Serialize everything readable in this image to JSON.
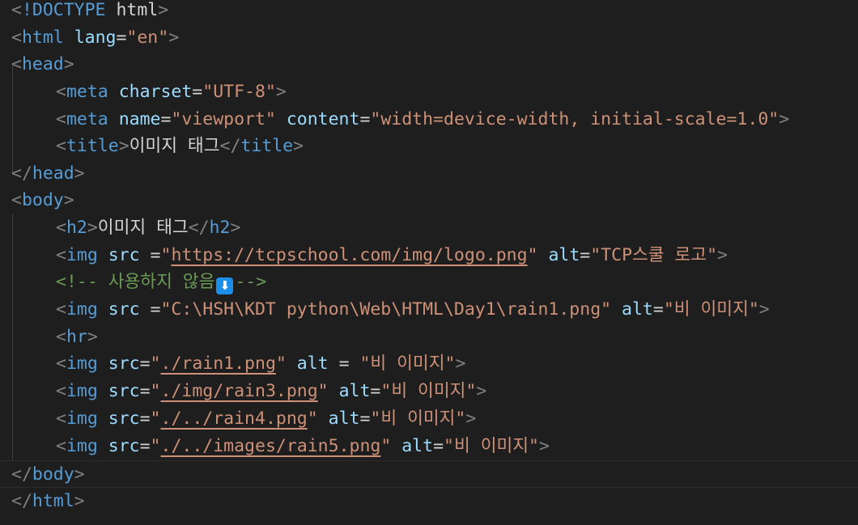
{
  "editor": {
    "theme": {
      "background": "#1e1e1e",
      "tag": "#569cd6",
      "attr": "#9cdcfe",
      "string": "#ce9178",
      "text": "#d4d4d4",
      "comment": "#6a9955",
      "punct": "#808080"
    },
    "lines": [
      {
        "lt": "<",
        "tag": "!DOCTYPE",
        "sp": " ",
        "txt": "html",
        "gt": ">"
      },
      {
        "lt": "<",
        "tag": "html",
        "a1": "lang",
        "eq1": "=",
        "v1": "\"en\"",
        "gt": ">"
      },
      {
        "lt": "<",
        "tag": "head",
        "gt": ">"
      },
      {
        "lt": "<",
        "tag": "meta",
        "a1": "charset",
        "eq1": "=",
        "v1": "\"UTF-8\"",
        "gt": ">"
      },
      {
        "lt": "<",
        "tag": "meta",
        "a1": "name",
        "eq1": "=",
        "v1": "\"viewport\"",
        "a2": "content",
        "eq2": "=",
        "v2": "\"width=device-width, initial-scale=1.0\"",
        "gt": ">"
      },
      {
        "lt": "<",
        "tag": "title",
        "gt": ">",
        "txt": "이미지 태그",
        "lt2": "</",
        "tag2": "title",
        "gt2": ">"
      },
      {
        "lt": "</",
        "tag": "head",
        "gt": ">"
      },
      {
        "lt": "<",
        "tag": "body",
        "gt": ">"
      },
      {
        "lt": "<",
        "tag": "h2",
        "gt": ">",
        "txt": "이미지 태그",
        "lt2": "</",
        "tag2": "h2",
        "gt2": ">"
      },
      {
        "lt": "<",
        "tag": "img",
        "a1": "src",
        "eq1": " =",
        "q1": "\"",
        "url": "https://tcpschool.com/img/logo.png",
        "q2": "\"",
        "a2": "alt",
        "eq2": "=",
        "v2": "\"TCP스쿨 로고\"",
        "gt": ">"
      },
      {
        "open": "<!-- ",
        "body": "사용하지 않음",
        "emoji": "⬇",
        "close": "-->"
      },
      {
        "lt": "<",
        "tag": "img",
        "a1": "src",
        "eq1": " =",
        "v1": "\"C:\\HSH\\KDT python\\Web\\HTML\\Day1\\rain1.png\"",
        "a2": "alt",
        "eq2": "=",
        "v2": "\"비 이미지\"",
        "gt": ">"
      },
      {
        "lt": "<",
        "tag": "hr",
        "gt": ">"
      },
      {
        "lt": "<",
        "tag": "img",
        "a1": "src",
        "eq1": "=",
        "q1": "\"",
        "url": "./rain1.png",
        "q2": "\"",
        "a2": "alt",
        "eq2": " = ",
        "v2": "\"비 이미지\"",
        "gt": ">"
      },
      {
        "lt": "<",
        "tag": "img",
        "a1": "src",
        "eq1": "=",
        "q1": "\"",
        "url": "./img/rain3.png",
        "q2": "\"",
        "a2": "alt",
        "eq2": "=",
        "v2": "\"비 이미지\"",
        "gt": ">"
      },
      {
        "lt": "<",
        "tag": "img",
        "a1": "src",
        "eq1": "=",
        "q1": "\"",
        "url": "./../rain4.png",
        "q2": "\"",
        "a2": "alt",
        "eq2": "=",
        "v2": "\"비 이미지\"",
        "gt": ">"
      },
      {
        "lt": "<",
        "tag": "img",
        "a1": "src",
        "eq1": "=",
        "q1": "\"",
        "url": "./../images/rain5.png",
        "q2": "\"",
        "a2": "alt",
        "eq2": "=",
        "v2": "\"비 이미지\"",
        "gt": ">"
      },
      {
        "lt": "</",
        "tag": "body",
        "gt": ">"
      },
      {
        "lt": "</",
        "tag": "html",
        "gt": ">"
      }
    ]
  }
}
